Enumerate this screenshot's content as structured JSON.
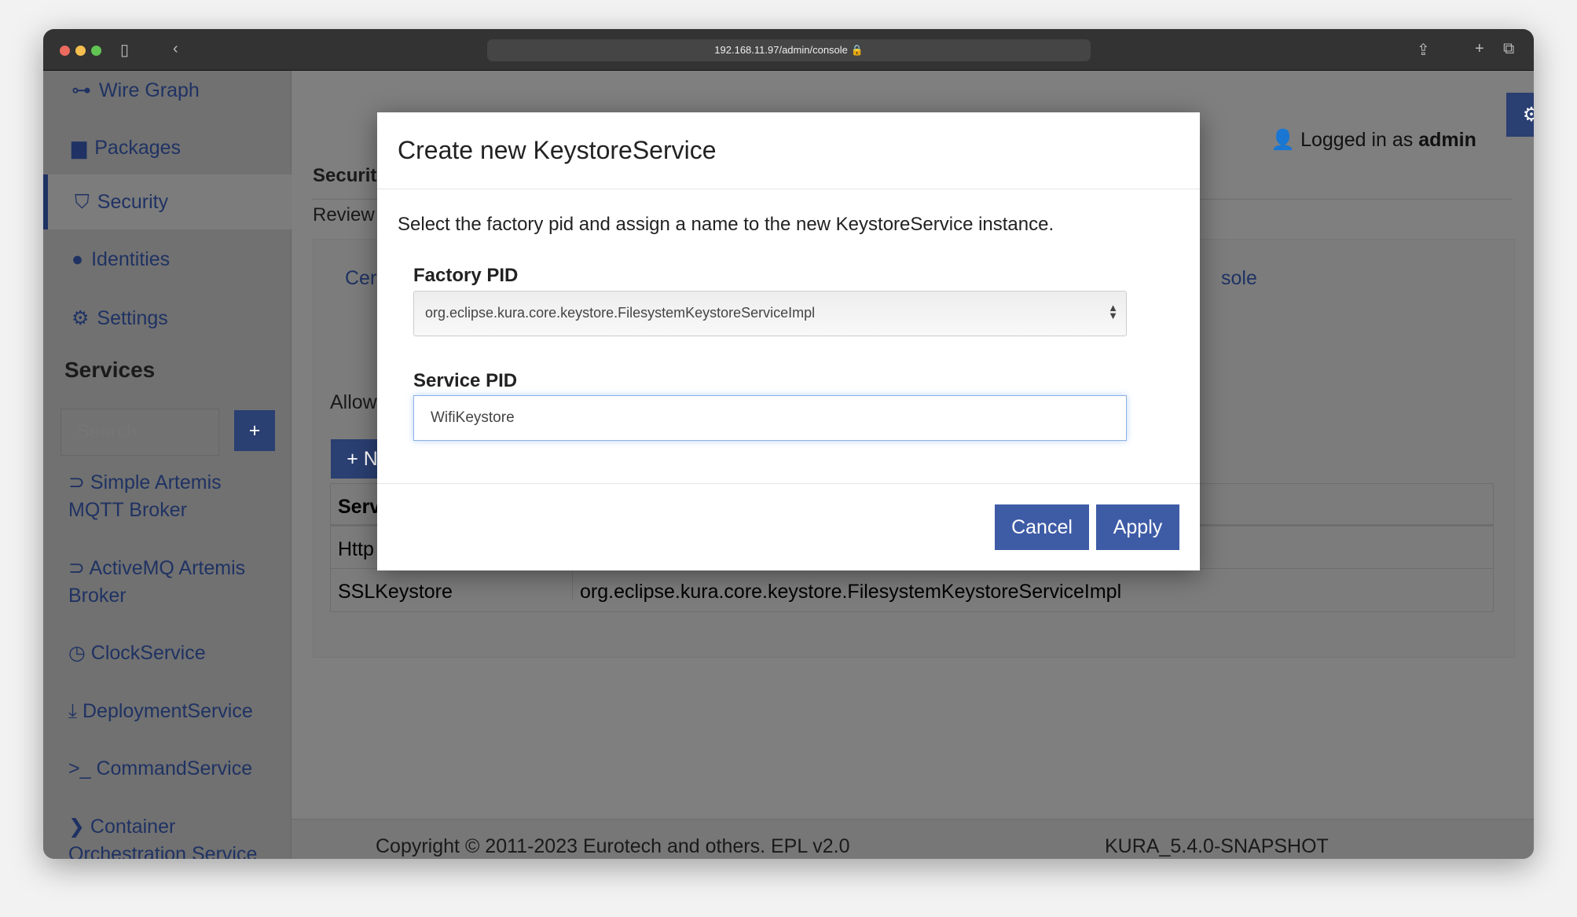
{
  "browser": {
    "url": "192.168.11.97/admin/console"
  },
  "sidebar": {
    "items": [
      {
        "label": "Wire Graph",
        "icon": "wire-graph-icon"
      },
      {
        "label": "Packages",
        "icon": "briefcase-icon"
      },
      {
        "label": "Security",
        "icon": "shield-icon"
      },
      {
        "label": "Identities",
        "icon": "user-icon"
      },
      {
        "label": "Settings",
        "icon": "gear-icon"
      }
    ],
    "services_title": "Services",
    "search_placeholder": "Search",
    "add_label": "+",
    "services": [
      {
        "label": "Simple Artemis MQTT Broker",
        "icon": "rss-icon"
      },
      {
        "label": "ActiveMQ Artemis Broker",
        "icon": "rss-icon"
      },
      {
        "label": "ClockService",
        "icon": "clock-icon"
      },
      {
        "label": "DeploymentService",
        "icon": "download-icon"
      },
      {
        "label": "CommandService",
        "icon": "terminal-icon"
      },
      {
        "label": "Container Orchestration Service",
        "icon": "chevron-circle-icon"
      }
    ]
  },
  "header": {
    "logged_in_prefix": "Logged in as",
    "user": "admin"
  },
  "main": {
    "title": "Securit",
    "subtitle": "Review",
    "tab_left": "Cer",
    "tab_right": "sole",
    "allow": "Allow",
    "new_btn": "+ N",
    "table": {
      "header": "Serv",
      "rows": [
        [
          "Http",
          ""
        ],
        [
          "SSLKeystore",
          "org.eclipse.kura.core.keystore.FilesystemKeystoreServiceImpl"
        ]
      ]
    }
  },
  "footer": {
    "copyright": "Copyright © 2011-2023 Eurotech and others. EPL v2.0",
    "version": "KURA_5.4.0-SNAPSHOT"
  },
  "dialog": {
    "title": "Create new KeystoreService",
    "description": "Select the factory pid and assign a name to the new KeystoreService instance.",
    "factory_label": "Factory PID",
    "factory_value": "org.eclipse.kura.core.keystore.FilesystemKeystoreServiceImpl",
    "service_label": "Service PID",
    "service_value": "WifiKeystore",
    "cancel": "Cancel",
    "apply": "Apply"
  },
  "colors": {
    "accent": "#3e5ba6"
  }
}
